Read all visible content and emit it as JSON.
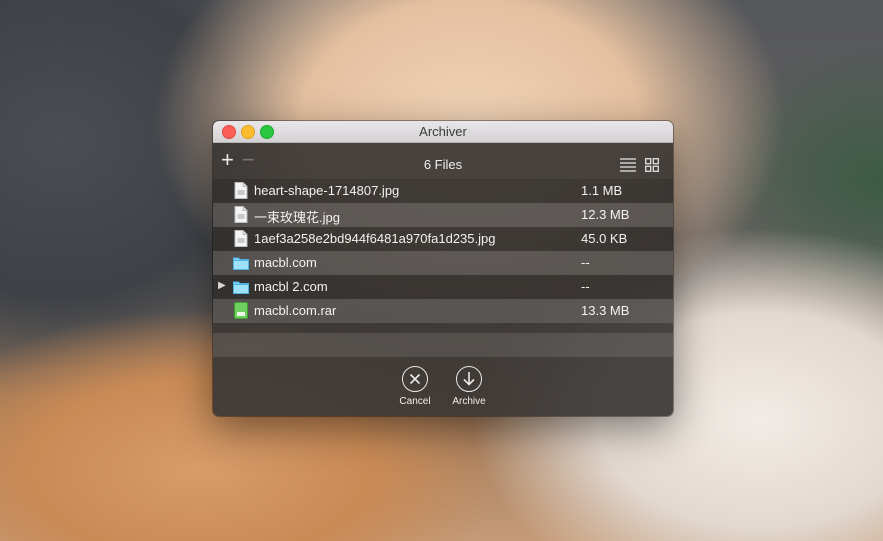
{
  "window": {
    "title": "Archiver"
  },
  "toolbar": {
    "file_count": "6 Files"
  },
  "files": [
    {
      "name": "heart-shape-1714807.jpg",
      "size": "1.1 MB",
      "type": "image",
      "expandable": false
    },
    {
      "name": "一束玫瑰花.jpg",
      "size": "12.3 MB",
      "type": "image",
      "expandable": false
    },
    {
      "name": "1aef3a258e2bd944f6481a970fa1d235.jpg",
      "size": "45.0 KB",
      "type": "image",
      "expandable": false
    },
    {
      "name": "macbl.com",
      "size": "--",
      "type": "folder",
      "expandable": false
    },
    {
      "name": "macbl 2.com",
      "size": "--",
      "type": "folder",
      "expandable": true
    },
    {
      "name": "macbl.com.rar",
      "size": "13.3 MB",
      "type": "archive",
      "expandable": false
    }
  ],
  "actions": {
    "cancel_label": "Cancel",
    "archive_label": "Archive"
  },
  "colors": {
    "folder": "#7dd3f5",
    "archive": "#6fd060",
    "close": "#fc5f57",
    "minimize": "#fdbc2e",
    "zoom": "#29c840"
  }
}
